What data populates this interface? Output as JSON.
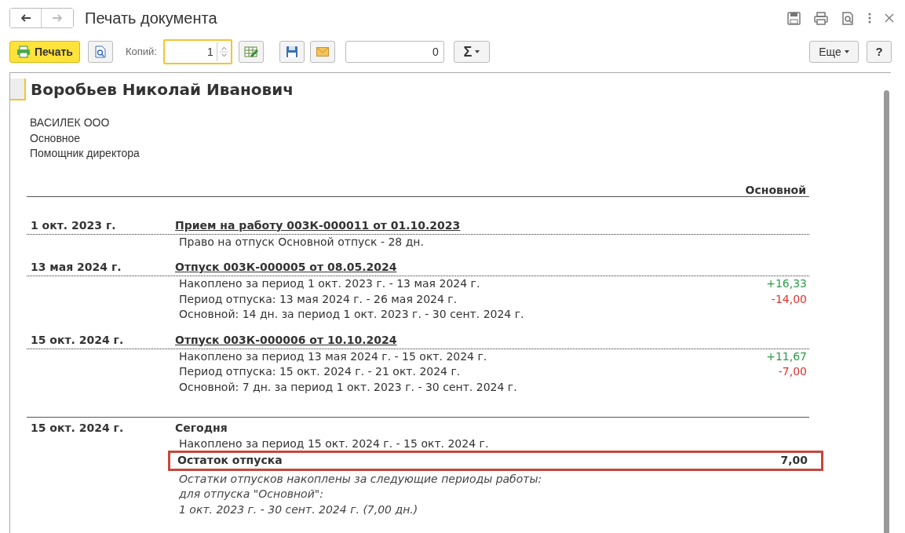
{
  "window": {
    "title": "Печать документа"
  },
  "toolbar": {
    "print_button": "Печать",
    "copies_label": "Копий:",
    "copies_value": "1",
    "sum_value": "0",
    "sum_button": "Σ",
    "more_button": "Еще",
    "help_button": "?"
  },
  "document": {
    "employee": "Воробьев Николай Иванович",
    "details": [
      "ВАСИЛЕК ООО",
      "Основное",
      "Помощник директора"
    ],
    "column_header": "Основной",
    "events": [
      {
        "date": "1 окт. 2023 г.",
        "title": "Прием на работу 003К-000011 от 01.10.2023",
        "kind": "document",
        "lines": [
          {
            "text": "Право на отпуск Основной отпуск - 28 дн."
          }
        ]
      },
      {
        "date": "13 мая 2024 г.",
        "title": "Отпуск 003К-000005 от 08.05.2024",
        "kind": "document",
        "lines": [
          {
            "text": "Накоплено за период 1 окт. 2023 г. - 13 мая 2024 г.",
            "value": "+16,33",
            "kind": "accrual"
          },
          {
            "text": "Период отпуска: 13 мая 2024 г. - 26 мая 2024 г.",
            "value": "-14,00",
            "kind": "deduction"
          },
          {
            "text": "Основной: 14 дн. за период 1 окт. 2023 г. - 30 сент. 2024 г."
          }
        ]
      },
      {
        "date": "15 окт. 2024 г.",
        "title": "Отпуск 003К-000006 от 10.10.2024",
        "kind": "document",
        "lines": [
          {
            "text": "Накоплено за период 13 мая 2024 г. - 15 окт. 2024 г.",
            "value": "+11,67",
            "kind": "accrual"
          },
          {
            "text": "Период отпуска: 15 окт. 2024 г. - 21 окт. 2024 г.",
            "value": "-7,00",
            "kind": "deduction"
          },
          {
            "text": "Основной: 7 дн. за период 1 окт. 2023 г. - 30 сент. 2024 г."
          }
        ]
      },
      {
        "date": "15 окт. 2024 г.",
        "title": "Сегодня",
        "kind": "today",
        "lines": [
          {
            "text": "Накоплено за период 15 окт. 2024 г. - 15 окт. 2024 г."
          }
        ]
      }
    ],
    "remainder": {
      "label": "Остаток отпуска",
      "value": "7,00",
      "highlighted": true
    },
    "notes": [
      "Остатки отпусков накоплены за следующие периоды работы:",
      "для отпуска \"Основной\":",
      "1 окт. 2023 г. - 30 сент. 2024 г. (7,00 дн.)"
    ]
  }
}
